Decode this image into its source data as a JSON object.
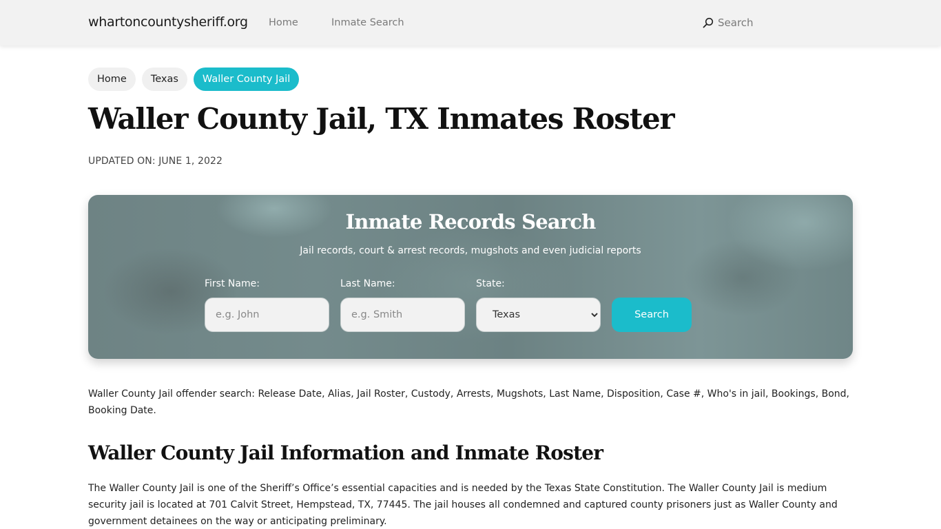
{
  "navbar": {
    "brand": "whartoncountysheriff.org",
    "links": [
      {
        "label": "Home"
      },
      {
        "label": "Inmate Search"
      }
    ],
    "search": {
      "icon": "search-icon",
      "label": "Search"
    }
  },
  "breadcrumb": [
    {
      "label": "Home",
      "active": false
    },
    {
      "label": "Texas",
      "active": false
    },
    {
      "label": "Waller County Jail",
      "active": true
    }
  ],
  "page": {
    "title": "Waller County Jail, TX Inmates Roster",
    "updated": "UPDATED ON: JUNE 1, 2022"
  },
  "search_panel": {
    "title": "Inmate Records Search",
    "subtitle": "Jail records, court & arrest records, mugshots and even judicial reports",
    "first_name": {
      "label": "First Name:",
      "placeholder": "e.g. John",
      "value": ""
    },
    "last_name": {
      "label": "Last Name:",
      "placeholder": "e.g. Smith",
      "value": ""
    },
    "state": {
      "label": "State:",
      "selected": "Texas"
    },
    "button_label": "Search"
  },
  "content": {
    "intro": "Waller County Jail offender search: Release Date, Alias, Jail Roster, Custody, Arrests, Mugshots, Last Name, Disposition, Case #, Who's in jail, Bookings, Bond, Booking Date.",
    "section_title": "Waller County Jail Information and Inmate Roster",
    "paragraph": "The Waller County Jail is one of the Sheriff’s Office’s essential capacities and is needed by the Texas State Constitution. The Waller County Jail is medium security jail is located at 701 Calvit Street, Hempstead, TX, 77445. The jail houses all condemned and captured county prisoners just as Waller County and government detainees on the way or anticipating preliminary."
  },
  "colors": {
    "accent": "#1bbccb",
    "navbar_bg": "#f2f2f2",
    "panel_bg": "#728889"
  }
}
